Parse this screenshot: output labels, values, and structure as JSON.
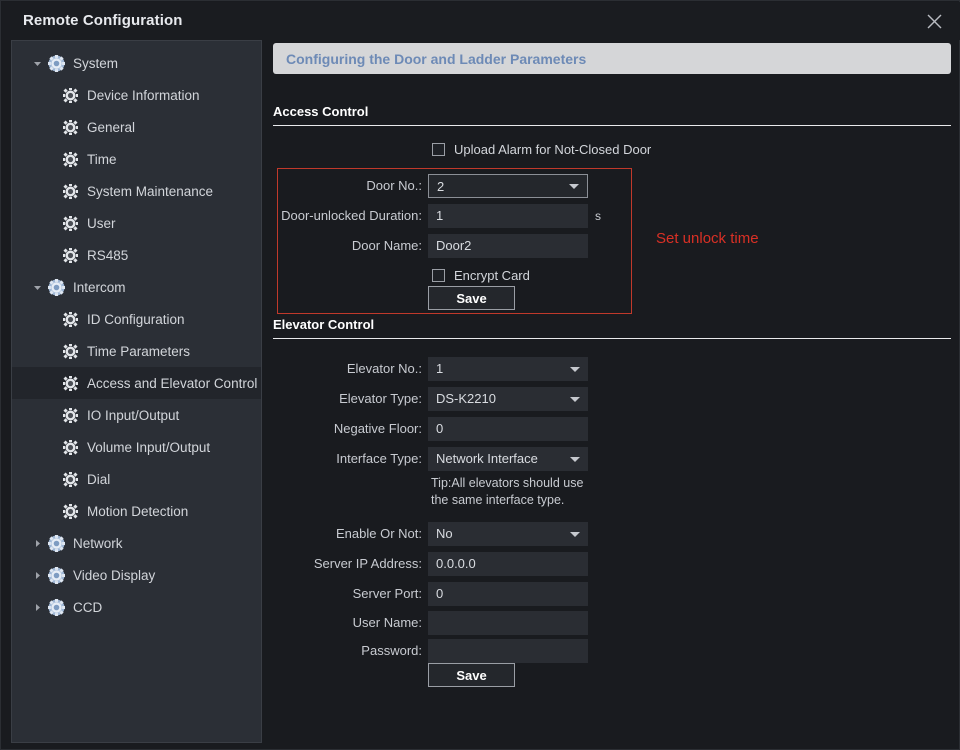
{
  "window": {
    "title": "Remote Configuration",
    "close_icon": "close-icon"
  },
  "sidebar": {
    "items": [
      {
        "label": "System",
        "level": 0,
        "expanded": true,
        "selected": false
      },
      {
        "label": "Device Information",
        "level": 1,
        "selected": false
      },
      {
        "label": "General",
        "level": 1,
        "selected": false
      },
      {
        "label": "Time",
        "level": 1,
        "selected": false
      },
      {
        "label": "System Maintenance",
        "level": 1,
        "selected": false
      },
      {
        "label": "User",
        "level": 1,
        "selected": false
      },
      {
        "label": "RS485",
        "level": 1,
        "selected": false
      },
      {
        "label": "Intercom",
        "level": 0,
        "expanded": true,
        "selected": false
      },
      {
        "label": "ID Configuration",
        "level": 1,
        "selected": false
      },
      {
        "label": "Time Parameters",
        "level": 1,
        "selected": false
      },
      {
        "label": "Access and Elevator Control",
        "level": 1,
        "selected": true
      },
      {
        "label": "IO Input/Output",
        "level": 1,
        "selected": false
      },
      {
        "label": "Volume Input/Output",
        "level": 1,
        "selected": false
      },
      {
        "label": "Dial",
        "level": 1,
        "selected": false
      },
      {
        "label": "Motion Detection",
        "level": 1,
        "selected": false
      },
      {
        "label": "Network",
        "level": 0,
        "expanded": false,
        "selected": false
      },
      {
        "label": "Video Display",
        "level": 0,
        "expanded": false,
        "selected": false
      },
      {
        "label": "CCD",
        "level": 0,
        "expanded": false,
        "selected": false
      }
    ]
  },
  "content": {
    "banner": "Configuring the Door and Ladder Parameters",
    "access_control": {
      "title": "Access Control",
      "upload_alarm_label": "Upload Alarm for Not-Closed Door",
      "upload_alarm_checked": false,
      "door_no_label": "Door No.:",
      "door_no_value": "2",
      "duration_label": "Door-unlocked Duration:",
      "duration_value": "1",
      "duration_unit": "s",
      "door_name_label": "Door Name:",
      "door_name_value": "Door2",
      "encrypt_card_label": "Encrypt Card",
      "encrypt_card_checked": false,
      "save_label": "Save"
    },
    "elevator_control": {
      "title": "Elevator Control",
      "elevator_no_label": "Elevator No.:",
      "elevator_no_value": "1",
      "elevator_type_label": "Elevator Type:",
      "elevator_type_value": "DS-K2210",
      "negative_floor_label": "Negative Floor:",
      "negative_floor_value": "0",
      "interface_type_label": "Interface Type:",
      "interface_type_value": "Network Interface",
      "tip": "Tip:All elevators should use the same interface type.",
      "enable_label": "Enable Or Not:",
      "enable_value": "No",
      "server_ip_label": "Server IP Address:",
      "server_ip_value": "0.0.0.0",
      "server_port_label": "Server Port:",
      "server_port_value": "0",
      "user_name_label": "User Name:",
      "user_name_value": "",
      "password_label": "Password:",
      "password_value": "",
      "save_label": "Save"
    },
    "annotation": "Set unlock time"
  },
  "colors": {
    "annotation_red": "#d93025",
    "highlight_box_red": "#c0392b",
    "banner_bg": "#d5d6d8",
    "banner_text": "#6d8ab6"
  }
}
